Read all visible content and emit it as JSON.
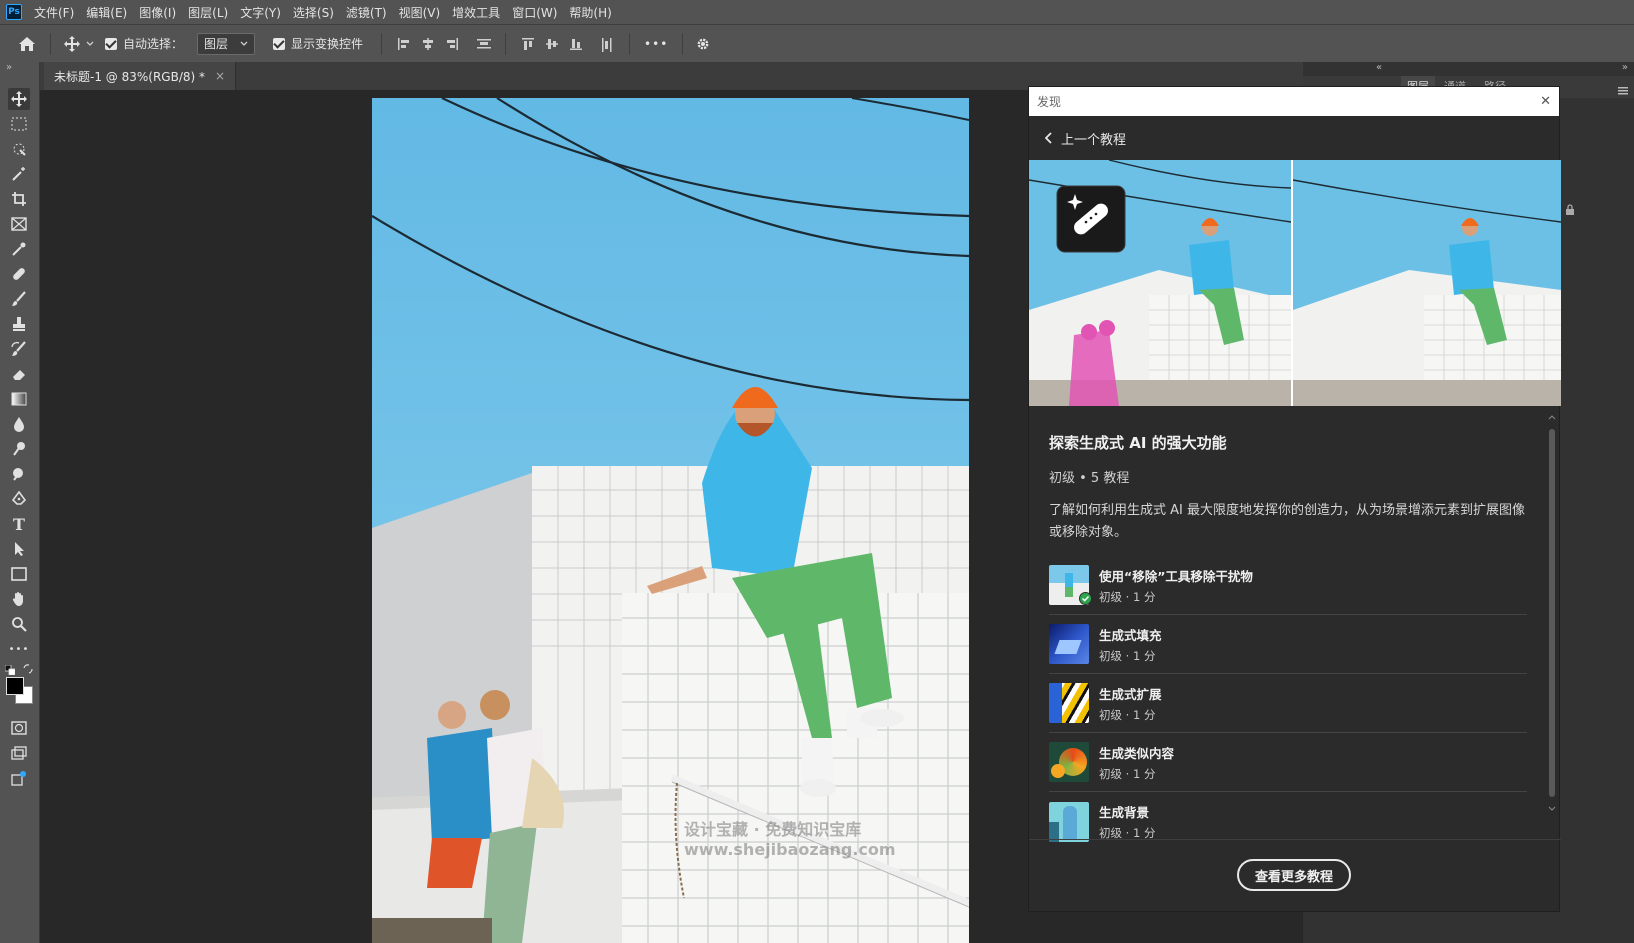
{
  "app": {
    "logo": "Ps"
  },
  "menu": [
    "文件(F)",
    "编辑(E)",
    "图像(I)",
    "图层(L)",
    "文字(Y)",
    "选择(S)",
    "滤镜(T)",
    "视图(V)",
    "增效工具",
    "窗口(W)",
    "帮助(H)"
  ],
  "options": {
    "auto_select_label": "自动选择：",
    "auto_select_value": "图层",
    "show_transform_label": "显示变换控件",
    "more": "•••"
  },
  "document": {
    "tab_title": "未标题-1 @ 83%(RGB/8) *",
    "close": "×"
  },
  "right_panel_tabs": [
    "图层",
    "通道",
    "路径"
  ],
  "discover": {
    "header": "发现",
    "close": "✕",
    "back_label": "上一个教程",
    "title": "探索生成式 AI 的强大功能",
    "meta": "初级 • 5 教程",
    "description": "了解如何利用生成式 AI 最大限度地发挥你的创造力，从为场景增添元素到扩展图像或移除对象。",
    "tutorials": [
      {
        "name": "使用“移除”工具移除干扰物",
        "meta": "初级 · 1 分",
        "completed": true
      },
      {
        "name": "生成式填充",
        "meta": "初级 · 1 分",
        "completed": false
      },
      {
        "name": "生成式扩展",
        "meta": "初级 · 1 分",
        "completed": false
      },
      {
        "name": "生成类似内容",
        "meta": "初级 · 1 分",
        "completed": false
      },
      {
        "name": "生成背景",
        "meta": "初级 · 1 分",
        "completed": false
      }
    ],
    "more_button": "查看更多教程"
  },
  "watermark": {
    "line1": "设计宝藏 · 免费知识宝库",
    "line2": "www.shejibaozang.com"
  },
  "colors": {
    "accent_check": "#2ea44f",
    "sky": "#6bbde3",
    "ui_bg": "#535353",
    "panel_bg": "#2b2b2b"
  }
}
